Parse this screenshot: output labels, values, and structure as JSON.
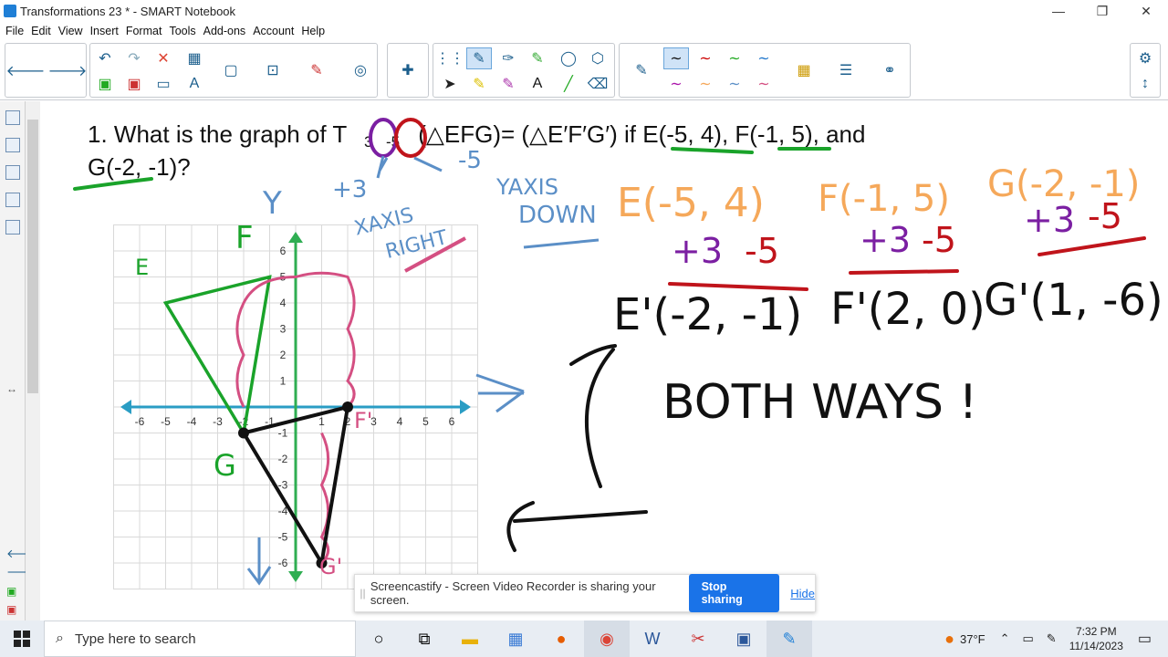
{
  "window": {
    "title": "Transformations 23 * - SMART Notebook",
    "controls": [
      "—",
      "❐",
      "✕"
    ]
  },
  "menu": [
    "File",
    "Edit",
    "View",
    "Insert",
    "Format",
    "Tools",
    "Add-ons",
    "Account",
    "Help"
  ],
  "question": {
    "line1_a": "1.  What is the graph of T",
    "vec_x": "3",
    "vec_y": "-5",
    "line1_b": "(△EFG)= (△E′F′G′) if",
    "E": "E(-5, 4)",
    "F": "F(-1, 5)",
    "and": ", and",
    "line2": "G(-2, -1)?"
  },
  "annotations": {
    "plus3": "+3",
    "minus5": "-5",
    "yaxis": "YAXIS",
    "down": "DOWN",
    "xaxis": "XAXIS",
    "right": "RIGHT",
    "E_label": "E",
    "F_label": "F",
    "y_label": "Y",
    "G_label": "G",
    "e_orig": "E(-5, 4)",
    "f_orig": "F(-1, 5)",
    "g_orig": "G(-2, -1)",
    "e_ops_a": "+3",
    "e_ops_b": "-5",
    "f_ops_a": "+3",
    "f_ops_b": "-5",
    "g_ops_a": "+3",
    "g_ops_b": "-5",
    "e_prime": "E'(-2, -1)",
    "f_prime": "F'(2, 0)",
    "g_prime": "G'(1, -6)",
    "both": "BOTH WAYS !",
    "g_prime_tag": "G'",
    "f_prime_tag": "F'"
  },
  "graph": {
    "xticks": [
      "-6",
      "-5",
      "-4",
      "-3",
      "-2",
      "-1",
      "1",
      "2",
      "3",
      "4",
      "5",
      "6"
    ],
    "yticks": [
      "6",
      "5",
      "4",
      "3",
      "2",
      "1",
      "-1",
      "-2",
      "-3",
      "-4",
      "-5",
      "-6"
    ]
  },
  "sharebar": {
    "message": "Screencastify - Screen Video Recorder is sharing your screen.",
    "stop": "Stop sharing",
    "hide": "Hide"
  },
  "taskbar": {
    "search_placeholder": "Type here to search",
    "weather": "37°F",
    "time": "7:32 PM",
    "date": "11/14/2023"
  },
  "colors": {
    "accent": "#1a73e8",
    "green": "#1aa32a",
    "pink": "#d44f82",
    "purple": "#7b1fa2",
    "red": "#c0141b",
    "orange": "#f5a85a",
    "blue_ink": "#5b8fc7"
  }
}
